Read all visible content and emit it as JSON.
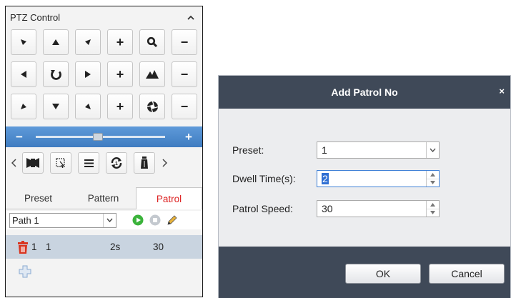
{
  "ptz": {
    "title": "PTZ Control",
    "collapse_icon": "chevron-up-icon",
    "direction_buttons": [
      {
        "name": "pan-up-left-button",
        "icon": "arrow-up-left-icon"
      },
      {
        "name": "pan-up-button",
        "icon": "arrow-up-icon"
      },
      {
        "name": "pan-up-right-button",
        "icon": "arrow-up-right-icon"
      },
      {
        "name": "zoom-in-button",
        "label": "+"
      },
      {
        "name": "zoom-icon-label",
        "icon": "magnifier-icon"
      },
      {
        "name": "zoom-out-button",
        "label": "−"
      },
      {
        "name": "pan-left-button",
        "icon": "arrow-left-icon"
      },
      {
        "name": "auto-scan-button",
        "icon": "rotate-icon"
      },
      {
        "name": "pan-right-button",
        "icon": "arrow-right-icon"
      },
      {
        "name": "focus-near-button",
        "label": "+"
      },
      {
        "name": "focus-icon-label",
        "icon": "mountain-icon"
      },
      {
        "name": "focus-far-button",
        "label": "−"
      },
      {
        "name": "pan-down-left-button",
        "icon": "arrow-down-left-icon"
      },
      {
        "name": "pan-down-button",
        "icon": "arrow-down-icon"
      },
      {
        "name": "pan-down-right-button",
        "icon": "arrow-down-right-icon"
      },
      {
        "name": "iris-open-button",
        "label": "+"
      },
      {
        "name": "iris-icon-label",
        "icon": "aperture-icon"
      },
      {
        "name": "iris-close-button",
        "label": "−"
      }
    ],
    "speed": {
      "minus": "−",
      "plus": "+",
      "level": 0.44
    },
    "tools": [
      "light-icon",
      "3d-zoom-icon",
      "menu-icon",
      "one-touch-patrol-icon",
      "wiper-icon"
    ],
    "tabs": [
      {
        "label": "Preset",
        "active": false
      },
      {
        "label": "Pattern",
        "active": false
      },
      {
        "label": "Patrol",
        "active": true
      }
    ],
    "path_select": "Path 1",
    "patrol_rows": [
      {
        "col1": "1",
        "col2": "1",
        "dwell": "2s",
        "speed": "30"
      }
    ]
  },
  "dialog": {
    "title": "Add Patrol No",
    "close_label": "×",
    "preset_label": "Preset:",
    "preset_value": "1",
    "dwell_label": "Dwell Time(s):",
    "dwell_value": "2",
    "speed_label": "Patrol Speed:",
    "speed_value": "30",
    "ok_label": "OK",
    "cancel_label": "Cancel"
  },
  "colors": {
    "accent_blue": "#4a8ad0",
    "dialog_header": "#3f4958",
    "active_tab_text": "#dd2222",
    "selected_row": "#c9d4e0"
  }
}
